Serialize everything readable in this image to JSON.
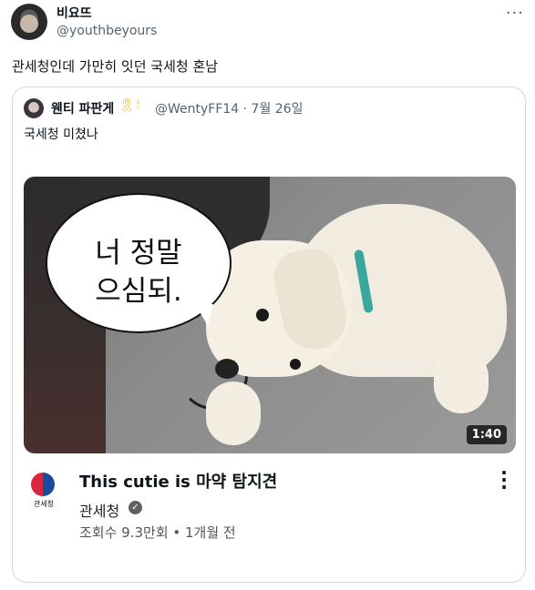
{
  "tweet": {
    "author_name": "비요뜨",
    "author_handle": "@youthbeyours",
    "more_icon": "more-horizontal-icon",
    "text": "관세청인데 가만히 잇던 국세청 혼남"
  },
  "quote": {
    "author_name": "웬티 파판게",
    "badges": [
      "yellow-ribbon-icon",
      "candle-icon"
    ],
    "handle_date": "@WentyFF14 · 7월 26일",
    "text": "국세청 미쳤나"
  },
  "video": {
    "speech_line1": "너 정말",
    "speech_line2": "으심되.",
    "duration": "1:40",
    "title": "This cutie is 마약 탐지견",
    "channel_name": "관세청",
    "channel_logo_label": "관세청",
    "stats": "조회수 9.3만회 • 1개월 전",
    "verified_icon": "check-circle-icon",
    "menu_icon": "more-vertical-icon"
  }
}
